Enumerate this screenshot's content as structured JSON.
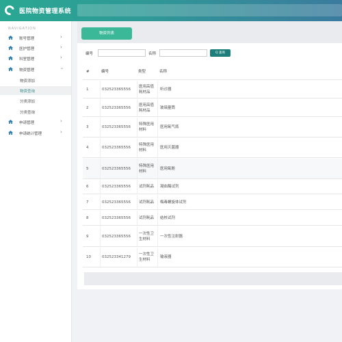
{
  "app": {
    "title": "医院物资管理系统"
  },
  "sidebar": {
    "caption": "NAVIGATION",
    "items": [
      {
        "label": "账号管理",
        "icon": "home-icon"
      },
      {
        "label": "医护管理",
        "icon": "home-icon"
      },
      {
        "label": "科室管理",
        "icon": "home-icon"
      },
      {
        "label": "物资管理",
        "icon": "home-icon"
      }
    ],
    "sub_items": [
      {
        "label": "物资添加"
      },
      {
        "label": "物资查询"
      },
      {
        "label": "分类添加"
      },
      {
        "label": "分类查询"
      }
    ],
    "items_after": [
      {
        "label": "申请管理",
        "icon": "home-icon"
      },
      {
        "label": "申请统计管理",
        "icon": "home-icon"
      }
    ]
  },
  "panel": {
    "tab_label": "物资列表",
    "filter": {
      "no_label": "编号",
      "name_label": "名称",
      "search_button": "Q 查询"
    },
    "table": {
      "headers": [
        "#",
        "编号",
        "类型",
        "名称"
      ],
      "rows": [
        {
          "idx": "1",
          "no": "032523365556",
          "type": "医用高值耗材品",
          "name": "听诊器"
        },
        {
          "idx": "2",
          "no": "032523365556",
          "type": "医用高值耗材品",
          "name": "玻璃量筒"
        },
        {
          "idx": "3",
          "no": "032523365556",
          "type": "特殊医用材料",
          "name": "医用氧气瓶"
        },
        {
          "idx": "4",
          "no": "032523365556",
          "type": "特殊医用材料",
          "name": "医用灭菌器"
        },
        {
          "idx": "5",
          "no": "032523365556",
          "type": "特殊医用材料",
          "name": "医用氧舱"
        },
        {
          "idx": "6",
          "no": "032523365556",
          "type": "试剂耗品",
          "name": "凝血酶试剂"
        },
        {
          "idx": "7",
          "no": "032523365556",
          "type": "试剂耗品",
          "name": "梅毒螺旋体试剂"
        },
        {
          "idx": "8",
          "no": "032523365556",
          "type": "试剂耗品",
          "name": "结核试剂"
        },
        {
          "idx": "9",
          "no": "032523365556",
          "type": "一次性卫生材料",
          "name": "一次性注射器"
        },
        {
          "idx": "10",
          "no": "032523341279",
          "type": "一次性卫生材料",
          "name": "输液器"
        }
      ]
    }
  },
  "colors": {
    "accent": "#3bb897",
    "header_start": "#2aa893",
    "header_end": "#3b7b9e",
    "button": "#1e7f7a"
  }
}
